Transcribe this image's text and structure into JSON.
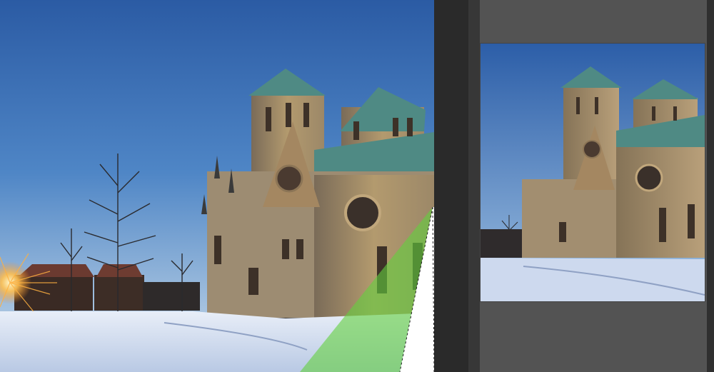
{
  "workspace": {
    "main_canvas": {
      "content": "cathedral-photo-with-crop-selection"
    },
    "preview": {
      "content": "cathedral-photo-preview"
    }
  },
  "colors": {
    "sky_top": "#2d5fa8",
    "sky_bottom": "#8fb4dc",
    "snow": "#d8e2f2",
    "stone": "#b39a6e",
    "roof": "#4f8a84",
    "selection_fill": "#63d13e",
    "panel_bg": "#535353",
    "divider": "#2a2a2a"
  }
}
